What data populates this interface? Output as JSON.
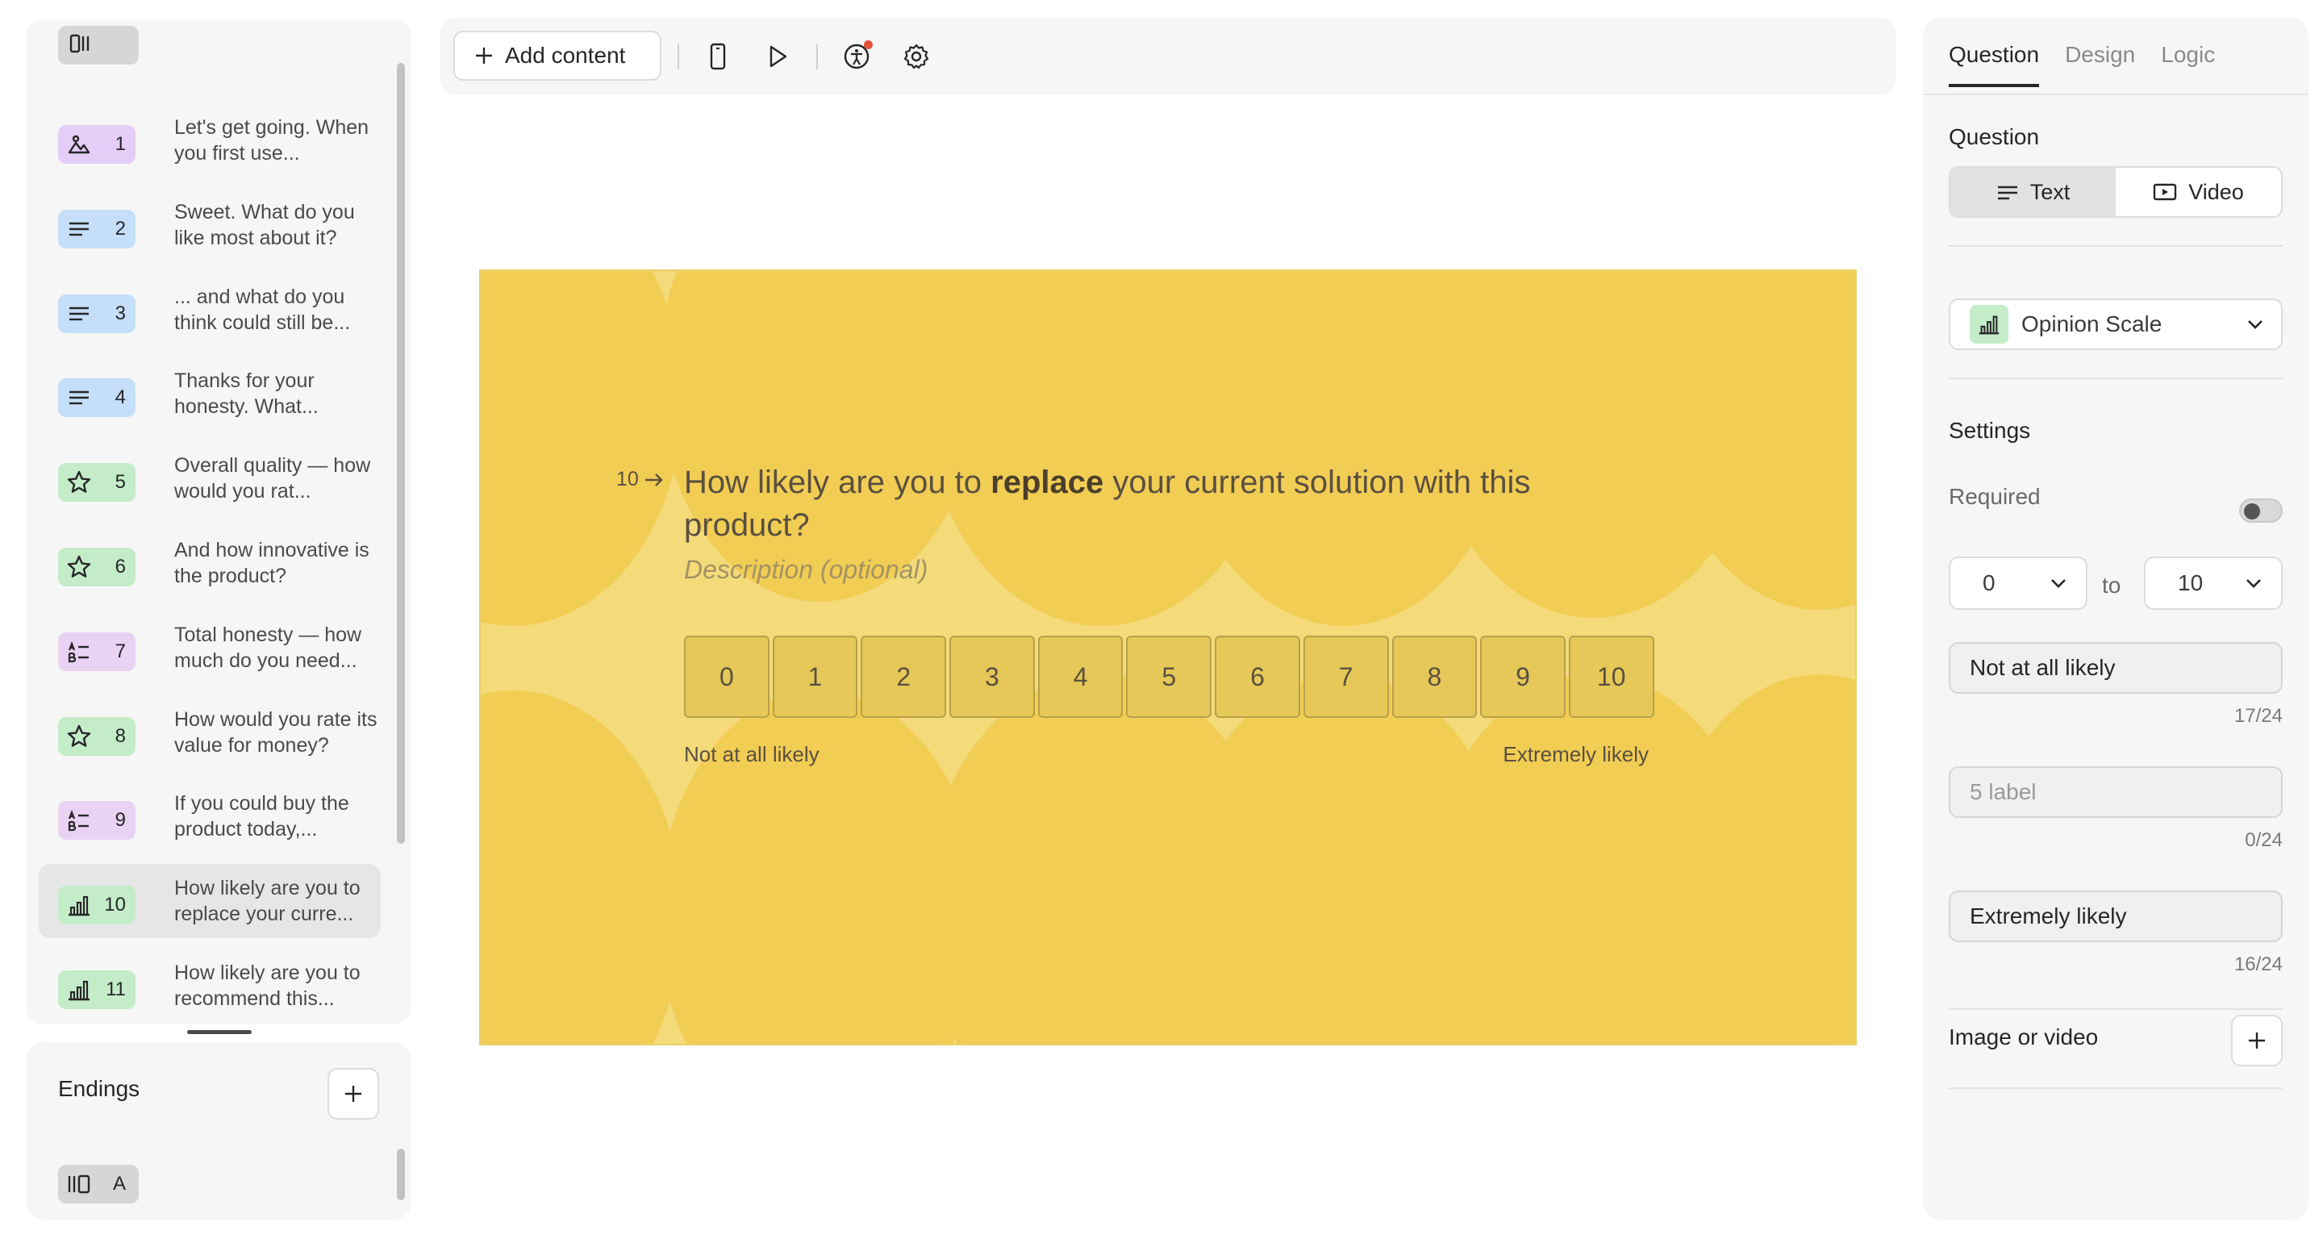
{
  "sidebar": {
    "questions": [
      {
        "num": "1",
        "icon": "image-icon",
        "color": "#e4cdf6",
        "text": "Let's get going. When you first use..."
      },
      {
        "num": "2",
        "icon": "text-lines-icon",
        "color": "#c5defa",
        "text": "Sweet. What do you like most about it?"
      },
      {
        "num": "3",
        "icon": "text-lines-icon",
        "color": "#c5defa",
        "text": "... and what do you think could still be..."
      },
      {
        "num": "4",
        "icon": "text-lines-icon",
        "color": "#c5defa",
        "text": "Thanks for your honesty. What..."
      },
      {
        "num": "5",
        "icon": "star-icon",
        "color": "#c4ecc9",
        "text": "Overall quality — how would you rat..."
      },
      {
        "num": "6",
        "icon": "star-icon",
        "color": "#c4ecc9",
        "text": "And how innovative is the product?"
      },
      {
        "num": "7",
        "icon": "multiple-choice-icon",
        "color": "#e9d2f3",
        "text": "Total honesty — how much do you need..."
      },
      {
        "num": "8",
        "icon": "star-icon",
        "color": "#c4ecc9",
        "text": "How would you rate its value for money?"
      },
      {
        "num": "9",
        "icon": "multiple-choice-icon",
        "color": "#e9d2f3",
        "text": "If you could buy the product today,..."
      },
      {
        "num": "10",
        "icon": "bar-chart-icon",
        "color": "#c4ecc9",
        "text": "How likely are you to replace your curre..."
      },
      {
        "num": "11",
        "icon": "bar-chart-icon",
        "color": "#c4ecc9",
        "text": "How likely are you to recommend this..."
      }
    ],
    "active_index": 9
  },
  "endings": {
    "title": "Endings",
    "items": [
      {
        "letter": "A",
        "icon": "ending-icon"
      }
    ]
  },
  "toolbar": {
    "add_content_label": "Add content"
  },
  "canvas": {
    "question_number": "10",
    "title_before": "How likely are you to ",
    "title_bold": "replace",
    "title_after": " your current solution with this product?",
    "description_placeholder": "Description (optional)",
    "scale": [
      "0",
      "1",
      "2",
      "3",
      "4",
      "5",
      "6",
      "7",
      "8",
      "9",
      "10"
    ],
    "label_left": "Not at all likely",
    "label_right": "Extremely likely",
    "background_color": "#f4da79",
    "accent_color": "#f2cd54"
  },
  "right_panel": {
    "tabs": [
      "Question",
      "Design",
      "Logic"
    ],
    "active_tab": "Question",
    "question_section": "Question",
    "media_options": [
      {
        "label": "Text",
        "icon": "text-icon",
        "active": true
      },
      {
        "label": "Video",
        "icon": "video-icon",
        "active": false
      }
    ],
    "question_type": "Opinion Scale",
    "settings_title": "Settings",
    "required_label": "Required",
    "required_on": false,
    "range_from": "0",
    "range_to_label": "to",
    "range_to": "10",
    "label_fields": [
      {
        "value": "Not at all likely",
        "placeholder": "",
        "counter": "17/24"
      },
      {
        "value": "",
        "placeholder": "5 label",
        "counter": "0/24"
      },
      {
        "value": "Extremely likely",
        "placeholder": "",
        "counter": "16/24"
      }
    ],
    "image_or_video_label": "Image or video"
  }
}
